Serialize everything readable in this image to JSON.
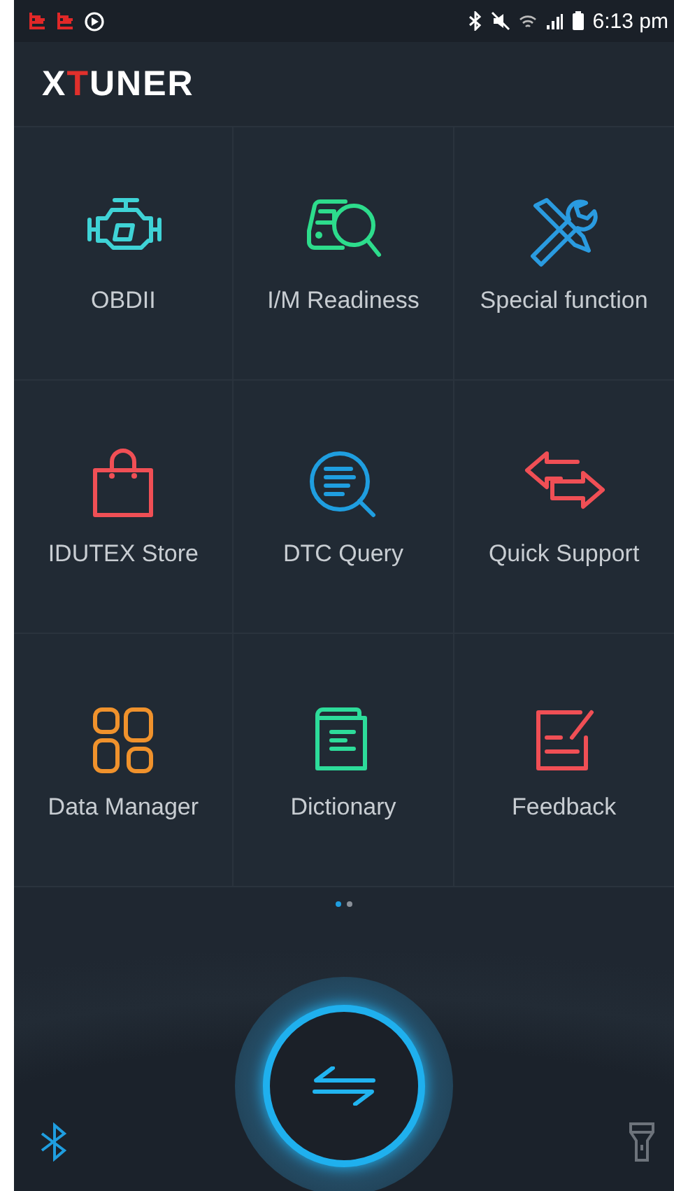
{
  "status_bar": {
    "time": "6:13 pm"
  },
  "logo": {
    "parts": [
      {
        "text": "X",
        "color": "#ffffff"
      },
      {
        "text": "T",
        "color": "#e0302c"
      },
      {
        "text": "UNER",
        "color": "#ffffff"
      }
    ]
  },
  "tiles": [
    {
      "label": "OBDII",
      "kind": "engine",
      "color": "#3fd3d6"
    },
    {
      "label": "I/M Readiness",
      "kind": "car-search",
      "color": "#2ddc8c"
    },
    {
      "label": "Special function",
      "kind": "tools",
      "color": "#2a9be0"
    },
    {
      "label": "IDUTEX Store",
      "kind": "bag",
      "color": "#f04f55"
    },
    {
      "label": "DTC Query",
      "kind": "doc-search",
      "color": "#1f9ee0"
    },
    {
      "label": "Quick Support",
      "kind": "arrows",
      "color": "#f04f55"
    },
    {
      "label": "Data Manager",
      "kind": "grid",
      "color": "#f0922c"
    },
    {
      "label": "Dictionary",
      "kind": "book",
      "color": "#2ddc9a"
    },
    {
      "label": "Feedback",
      "kind": "edit",
      "color": "#f04f55"
    }
  ],
  "pager": [
    {
      "selected": true
    },
    {
      "selected": false
    }
  ]
}
